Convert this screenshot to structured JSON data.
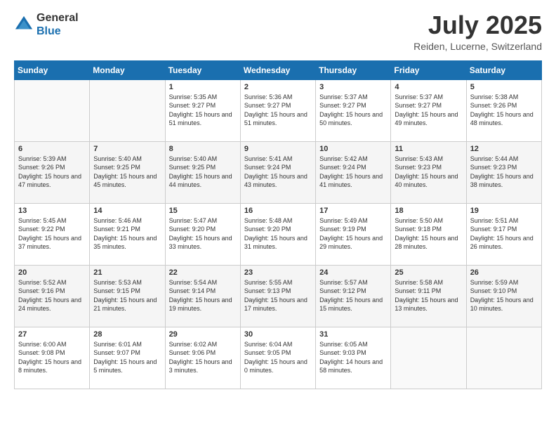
{
  "header": {
    "logo_line1": "General",
    "logo_line2": "Blue",
    "month": "July 2025",
    "location": "Reiden, Lucerne, Switzerland"
  },
  "weekdays": [
    "Sunday",
    "Monday",
    "Tuesday",
    "Wednesday",
    "Thursday",
    "Friday",
    "Saturday"
  ],
  "weeks": [
    [
      {
        "day": "",
        "sunrise": "",
        "sunset": "",
        "daylight": ""
      },
      {
        "day": "",
        "sunrise": "",
        "sunset": "",
        "daylight": ""
      },
      {
        "day": "1",
        "sunrise": "Sunrise: 5:35 AM",
        "sunset": "Sunset: 9:27 PM",
        "daylight": "Daylight: 15 hours and 51 minutes."
      },
      {
        "day": "2",
        "sunrise": "Sunrise: 5:36 AM",
        "sunset": "Sunset: 9:27 PM",
        "daylight": "Daylight: 15 hours and 51 minutes."
      },
      {
        "day": "3",
        "sunrise": "Sunrise: 5:37 AM",
        "sunset": "Sunset: 9:27 PM",
        "daylight": "Daylight: 15 hours and 50 minutes."
      },
      {
        "day": "4",
        "sunrise": "Sunrise: 5:37 AM",
        "sunset": "Sunset: 9:27 PM",
        "daylight": "Daylight: 15 hours and 49 minutes."
      },
      {
        "day": "5",
        "sunrise": "Sunrise: 5:38 AM",
        "sunset": "Sunset: 9:26 PM",
        "daylight": "Daylight: 15 hours and 48 minutes."
      }
    ],
    [
      {
        "day": "6",
        "sunrise": "Sunrise: 5:39 AM",
        "sunset": "Sunset: 9:26 PM",
        "daylight": "Daylight: 15 hours and 47 minutes."
      },
      {
        "day": "7",
        "sunrise": "Sunrise: 5:40 AM",
        "sunset": "Sunset: 9:25 PM",
        "daylight": "Daylight: 15 hours and 45 minutes."
      },
      {
        "day": "8",
        "sunrise": "Sunrise: 5:40 AM",
        "sunset": "Sunset: 9:25 PM",
        "daylight": "Daylight: 15 hours and 44 minutes."
      },
      {
        "day": "9",
        "sunrise": "Sunrise: 5:41 AM",
        "sunset": "Sunset: 9:24 PM",
        "daylight": "Daylight: 15 hours and 43 minutes."
      },
      {
        "day": "10",
        "sunrise": "Sunrise: 5:42 AM",
        "sunset": "Sunset: 9:24 PM",
        "daylight": "Daylight: 15 hours and 41 minutes."
      },
      {
        "day": "11",
        "sunrise": "Sunrise: 5:43 AM",
        "sunset": "Sunset: 9:23 PM",
        "daylight": "Daylight: 15 hours and 40 minutes."
      },
      {
        "day": "12",
        "sunrise": "Sunrise: 5:44 AM",
        "sunset": "Sunset: 9:23 PM",
        "daylight": "Daylight: 15 hours and 38 minutes."
      }
    ],
    [
      {
        "day": "13",
        "sunrise": "Sunrise: 5:45 AM",
        "sunset": "Sunset: 9:22 PM",
        "daylight": "Daylight: 15 hours and 37 minutes."
      },
      {
        "day": "14",
        "sunrise": "Sunrise: 5:46 AM",
        "sunset": "Sunset: 9:21 PM",
        "daylight": "Daylight: 15 hours and 35 minutes."
      },
      {
        "day": "15",
        "sunrise": "Sunrise: 5:47 AM",
        "sunset": "Sunset: 9:20 PM",
        "daylight": "Daylight: 15 hours and 33 minutes."
      },
      {
        "day": "16",
        "sunrise": "Sunrise: 5:48 AM",
        "sunset": "Sunset: 9:20 PM",
        "daylight": "Daylight: 15 hours and 31 minutes."
      },
      {
        "day": "17",
        "sunrise": "Sunrise: 5:49 AM",
        "sunset": "Sunset: 9:19 PM",
        "daylight": "Daylight: 15 hours and 29 minutes."
      },
      {
        "day": "18",
        "sunrise": "Sunrise: 5:50 AM",
        "sunset": "Sunset: 9:18 PM",
        "daylight": "Daylight: 15 hours and 28 minutes."
      },
      {
        "day": "19",
        "sunrise": "Sunrise: 5:51 AM",
        "sunset": "Sunset: 9:17 PM",
        "daylight": "Daylight: 15 hours and 26 minutes."
      }
    ],
    [
      {
        "day": "20",
        "sunrise": "Sunrise: 5:52 AM",
        "sunset": "Sunset: 9:16 PM",
        "daylight": "Daylight: 15 hours and 24 minutes."
      },
      {
        "day": "21",
        "sunrise": "Sunrise: 5:53 AM",
        "sunset": "Sunset: 9:15 PM",
        "daylight": "Daylight: 15 hours and 21 minutes."
      },
      {
        "day": "22",
        "sunrise": "Sunrise: 5:54 AM",
        "sunset": "Sunset: 9:14 PM",
        "daylight": "Daylight: 15 hours and 19 minutes."
      },
      {
        "day": "23",
        "sunrise": "Sunrise: 5:55 AM",
        "sunset": "Sunset: 9:13 PM",
        "daylight": "Daylight: 15 hours and 17 minutes."
      },
      {
        "day": "24",
        "sunrise": "Sunrise: 5:57 AM",
        "sunset": "Sunset: 9:12 PM",
        "daylight": "Daylight: 15 hours and 15 minutes."
      },
      {
        "day": "25",
        "sunrise": "Sunrise: 5:58 AM",
        "sunset": "Sunset: 9:11 PM",
        "daylight": "Daylight: 15 hours and 13 minutes."
      },
      {
        "day": "26",
        "sunrise": "Sunrise: 5:59 AM",
        "sunset": "Sunset: 9:10 PM",
        "daylight": "Daylight: 15 hours and 10 minutes."
      }
    ],
    [
      {
        "day": "27",
        "sunrise": "Sunrise: 6:00 AM",
        "sunset": "Sunset: 9:08 PM",
        "daylight": "Daylight: 15 hours and 8 minutes."
      },
      {
        "day": "28",
        "sunrise": "Sunrise: 6:01 AM",
        "sunset": "Sunset: 9:07 PM",
        "daylight": "Daylight: 15 hours and 5 minutes."
      },
      {
        "day": "29",
        "sunrise": "Sunrise: 6:02 AM",
        "sunset": "Sunset: 9:06 PM",
        "daylight": "Daylight: 15 hours and 3 minutes."
      },
      {
        "day": "30",
        "sunrise": "Sunrise: 6:04 AM",
        "sunset": "Sunset: 9:05 PM",
        "daylight": "Daylight: 15 hours and 0 minutes."
      },
      {
        "day": "31",
        "sunrise": "Sunrise: 6:05 AM",
        "sunset": "Sunset: 9:03 PM",
        "daylight": "Daylight: 14 hours and 58 minutes."
      },
      {
        "day": "",
        "sunrise": "",
        "sunset": "",
        "daylight": ""
      },
      {
        "day": "",
        "sunrise": "",
        "sunset": "",
        "daylight": ""
      }
    ]
  ]
}
